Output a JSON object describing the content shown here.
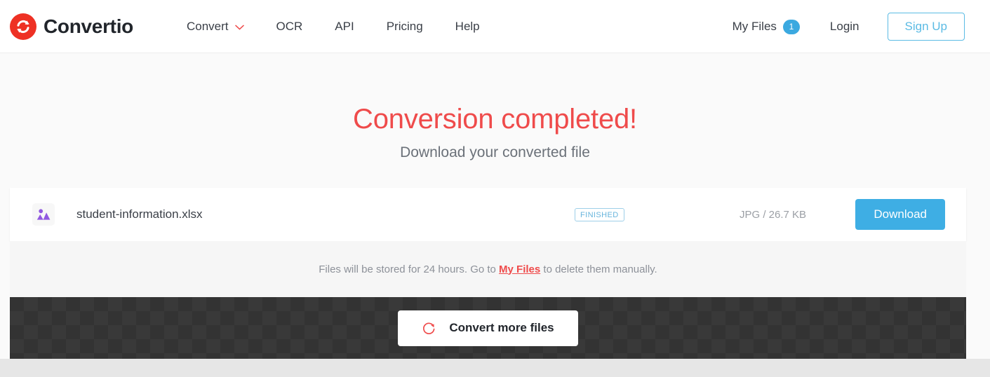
{
  "header": {
    "brand": {
      "name": "Convertio",
      "logo_icon": "convertio-refresh-logo",
      "logo_color": "#ee3124"
    },
    "nav": [
      {
        "label": "Convert",
        "icon": "chevron-down-icon",
        "has_dropdown": true
      },
      {
        "label": "OCR",
        "has_dropdown": false
      },
      {
        "label": "API",
        "has_dropdown": false
      },
      {
        "label": "Pricing",
        "has_dropdown": false
      },
      {
        "label": "Help",
        "has_dropdown": false
      }
    ],
    "my_files": {
      "label": "My Files",
      "badge_count": "1",
      "badge_color": "#3ba9e0"
    },
    "login_label": "Login",
    "signup_label": "Sign Up",
    "signup_color": "#5bbbe4"
  },
  "hero": {
    "title": "Conversion completed!",
    "title_color": "#ef4b4b",
    "subtitle": "Download your converted file"
  },
  "file_row": {
    "icon": "image-file-icon",
    "icon_color": "#9159e0",
    "name": "student-information.xlsx",
    "status": "FINISHED",
    "status_color": "#67b4dc",
    "meta": "JPG / 26.7 KB",
    "download_label": "Download",
    "download_color": "#3eaee4"
  },
  "notice": {
    "text_before": "Files will be stored for 24 hours. Go to ",
    "link_label": "My Files",
    "text_after": " to delete them manually.",
    "link_color": "#ef4b4b"
  },
  "footer": {
    "convert_more_label": "Convert more files",
    "refresh_icon": "refresh-icon",
    "refresh_color": "#ef4b4b"
  }
}
